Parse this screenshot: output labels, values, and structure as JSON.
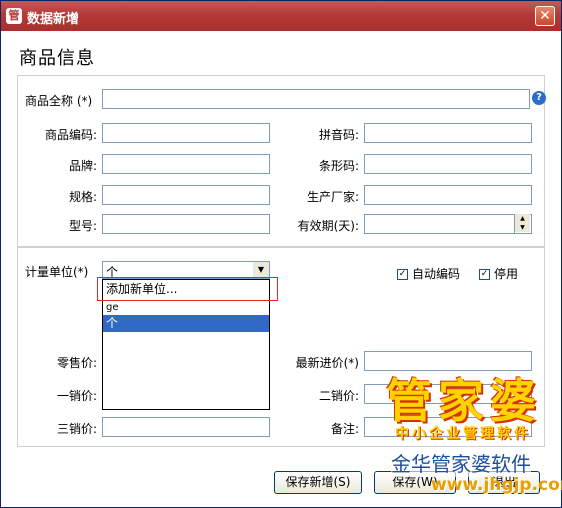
{
  "window": {
    "title": "数据新增",
    "close_glyph": "✕",
    "app_icon_glyph": "管"
  },
  "section_title": "商品信息",
  "fields": {
    "full_name": {
      "label": "商品全称 (*)",
      "value": ""
    },
    "code": {
      "label": "商品编码:",
      "value": ""
    },
    "pinyin": {
      "label": "拼音码:",
      "value": ""
    },
    "brand": {
      "label": "品牌:",
      "value": ""
    },
    "barcode": {
      "label": "条形码:",
      "value": ""
    },
    "spec": {
      "label": "规格:",
      "value": ""
    },
    "manufacturer": {
      "label": "生产厂家:",
      "value": ""
    },
    "model": {
      "label": "型号:",
      "value": ""
    },
    "shelf_life": {
      "label": "有效期(天):",
      "value": ""
    },
    "unit": {
      "label": "计量单位(*)",
      "value": "个"
    },
    "retail_price": {
      "label": "零售价:",
      "value": ""
    },
    "latest_purchase_price": {
      "label": "最新进价(*)",
      "value": ""
    },
    "price1": {
      "label": "一销价:",
      "value": ""
    },
    "price2": {
      "label": "二销价:",
      "value": ""
    },
    "price3": {
      "label": "三销价:",
      "value": ""
    },
    "remark": {
      "label": "备注:",
      "value": ""
    }
  },
  "unit_dropdown": {
    "options": [
      "添加新单位...",
      "ge",
      "个"
    ],
    "selected": "个"
  },
  "checkboxes": {
    "auto_code": {
      "label": "自动编码",
      "checked": true
    },
    "disabled": {
      "label": "停用",
      "checked": true
    }
  },
  "buttons": {
    "save_new": "保存新增(S)",
    "save_exit": "保存(W)",
    "exit": "退出"
  },
  "watermark": {
    "brand": "管家婆",
    "tagline": "中小企业管理软件",
    "company": "金华管家婆软件",
    "url": "www.jhgjp.com"
  },
  "icons": {
    "help": "?",
    "spin_up": "▲",
    "spin_down": "▼",
    "combo_arrow": "▼",
    "check": "✓"
  },
  "colors": {
    "title_bar": "#b43a37",
    "selection": "#316ac5",
    "highlight_box": "#e02a2a",
    "watermark_yellow": "#ffd200",
    "watermark_blue": "#1d4fa0"
  }
}
